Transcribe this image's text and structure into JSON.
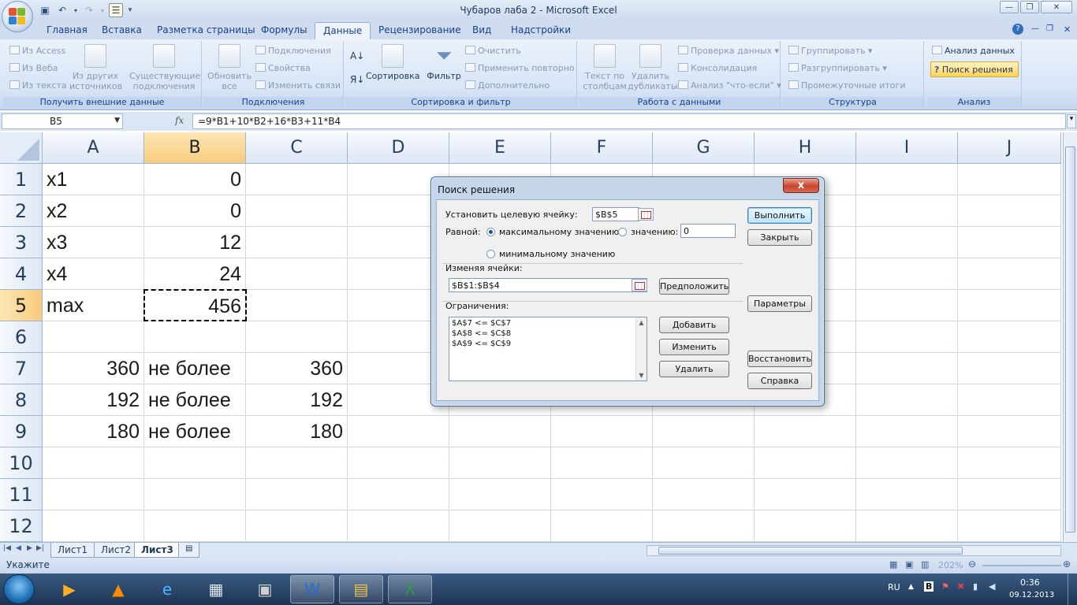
{
  "window": {
    "title": "Чубаров лаба 2 - Microsoft Excel"
  },
  "ribbon_tabs": [
    "Главная",
    "Вставка",
    "Разметка страницы",
    "Формулы",
    "Данные",
    "Рецензирование",
    "Вид",
    "Надстройки"
  ],
  "ribbon_active_tab": "Данные",
  "ribbon": {
    "get_external": {
      "label": "Получить внешние данные",
      "from_access": "Из Access",
      "from_web": "Из Веба",
      "from_text": "Из текста",
      "from_other": "Из других источников",
      "existing": "Существующие подключения"
    },
    "connections": {
      "label": "Подключения",
      "refresh_all": "Обновить все",
      "connections": "Подключения",
      "properties": "Свойства",
      "edit_links": "Изменить связи"
    },
    "sort_filter": {
      "label": "Сортировка и фильтр",
      "sort": "Сортировка",
      "filter": "Фильтр",
      "clear": "Очистить",
      "reapply": "Применить повторно",
      "advanced": "Дополнительно"
    },
    "data_tools": {
      "label": "Работа с данными",
      "text_to_columns": "Текст по столбцам",
      "remove_dupes": "Удалить дубликаты",
      "validation": "Проверка данных",
      "consolidate": "Консолидация",
      "what_if": "Анализ \"что-если\""
    },
    "outline": {
      "label": "Структура",
      "group": "Группировать",
      "ungroup": "Разгруппировать",
      "subtotal": "Промежуточные итоги"
    },
    "analysis": {
      "label": "Анализ",
      "data_analysis": "Анализ данных",
      "solver": "Поиск решения"
    }
  },
  "formula_bar": {
    "name_box": "B5",
    "fx": "fx",
    "formula": "=9*B1+10*B2+16*B3+11*B4"
  },
  "columns": [
    "A",
    "B",
    "C",
    "D",
    "E",
    "F",
    "G",
    "H",
    "I",
    "J"
  ],
  "rows": [
    "1",
    "2",
    "3",
    "4",
    "5",
    "6",
    "7",
    "8",
    "9",
    "10",
    "11",
    "12"
  ],
  "cells": {
    "A1": "x1",
    "B1": "0",
    "A2": "x2",
    "B2": "0",
    "A3": "x3",
    "B3": "12",
    "A4": "x4",
    "B4": "24",
    "A5": "max",
    "B5": "456",
    "A7": "360",
    "B7": "не более",
    "C7": "360",
    "A8": "192",
    "B8": "не более",
    "C8": "192",
    "A9": "180",
    "B9": "не более",
    "C9": "180"
  },
  "sheet_tabs": [
    "Лист1",
    "Лист2",
    "Лист3"
  ],
  "active_sheet": "Лист3",
  "status": {
    "mode": "Укажите",
    "zoom": "202%"
  },
  "taskbar": {
    "lang": "RU",
    "time": "0:36",
    "date": "09.12.2013"
  },
  "solver": {
    "title": "Поиск решения",
    "close": "x",
    "target_label": "Установить целевую ячейку:",
    "target_value": "$B$5",
    "equal_label": "Равной:",
    "max_label": "максимальному значению",
    "value_label": "значению:",
    "value_input": "0",
    "min_label": "минимальному значению",
    "changing_label": "Изменяя ячейки:",
    "changing_value": "$B$1:$B$4",
    "guess": "Предположить",
    "constraints_label": "Ограничения:",
    "constraints": [
      "$A$7 <= $C$7",
      "$A$8 <= $C$8",
      "$A$9 <= $C$9"
    ],
    "add": "Добавить",
    "change": "Изменить",
    "delete": "Удалить",
    "solve": "Выполнить",
    "close_btn": "Закрыть",
    "options": "Параметры",
    "reset": "Восстановить",
    "help": "Справка"
  }
}
